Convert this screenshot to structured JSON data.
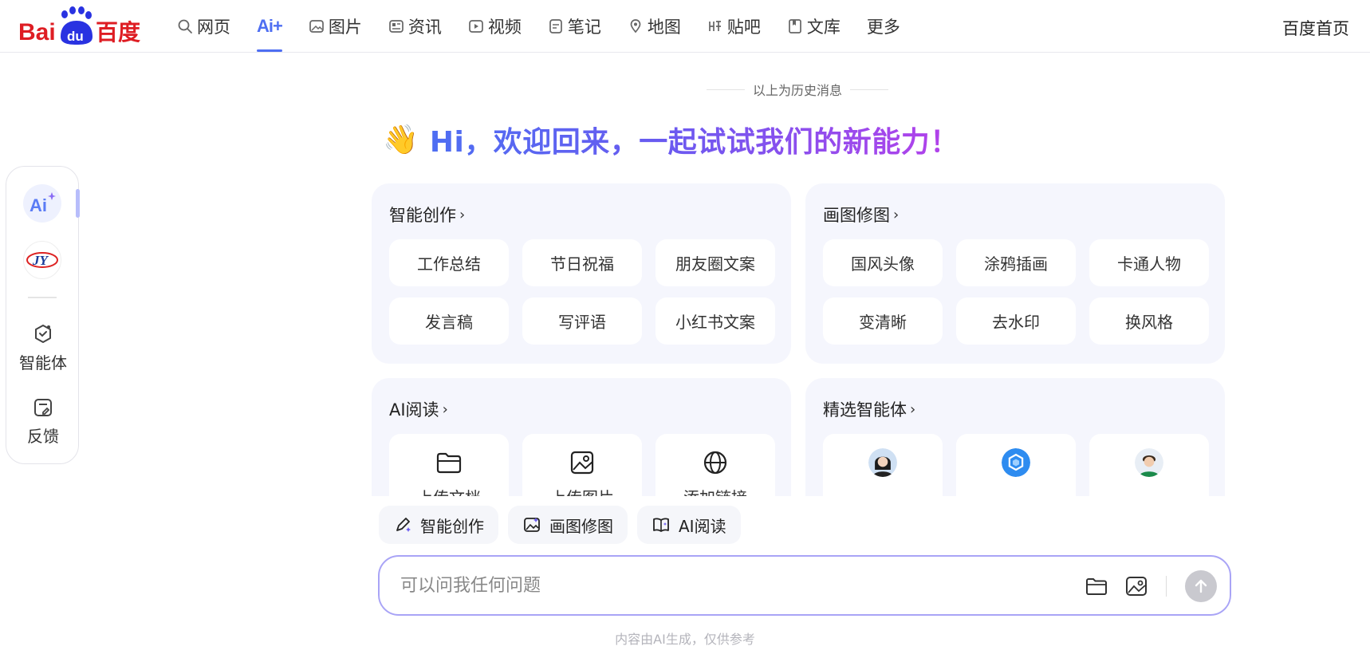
{
  "logo": {
    "text_left": "Bai",
    "text_du": "du",
    "text_right": "百度"
  },
  "nav": {
    "items": [
      {
        "label": "网页",
        "icon": "search-icon"
      },
      {
        "label": "Ai+",
        "icon": "ai-icon",
        "active": true
      },
      {
        "label": "图片",
        "icon": "image-icon"
      },
      {
        "label": "资讯",
        "icon": "news-icon"
      },
      {
        "label": "视频",
        "icon": "video-icon"
      },
      {
        "label": "笔记",
        "icon": "note-icon"
      },
      {
        "label": "地图",
        "icon": "map-icon"
      },
      {
        "label": "贴吧",
        "icon": "tieba-icon"
      },
      {
        "label": "文库",
        "icon": "library-icon"
      },
      {
        "label": "更多"
      }
    ],
    "home_link": "百度首页"
  },
  "rail": {
    "ai_avatar_label": "Ai",
    "jy_avatar_label": "JY",
    "agent_label": "智能体",
    "feedback_label": "反馈"
  },
  "history_label": "以上为历史消息",
  "greeting": {
    "emoji": "👋",
    "text": "Hi，欢迎回来，一起试试我们的新能力！"
  },
  "cards": {
    "creation": {
      "title": "智能创作",
      "chips": [
        "工作总结",
        "节日祝福",
        "朋友圈文案",
        "发言稿",
        "写评语",
        "小红书文案"
      ]
    },
    "image": {
      "title": "画图修图",
      "chips": [
        "国风头像",
        "涂鸦插画",
        "卡通人物",
        "变清晰",
        "去水印",
        "换风格"
      ]
    },
    "reading": {
      "title": "AI阅读",
      "tiles": [
        {
          "label": "上传文档",
          "icon": "folder-icon"
        },
        {
          "label": "上传图片",
          "icon": "image-icon"
        },
        {
          "label": "添加链接",
          "icon": "globe-icon"
        }
      ]
    },
    "agents": {
      "title": "精选智能体",
      "tiles": [
        {
          "label": "",
          "icon": "agent-avatar-woman"
        },
        {
          "label": "",
          "icon": "agent-avatar-cube"
        },
        {
          "label": "",
          "icon": "agent-avatar-man"
        }
      ]
    }
  },
  "pills": [
    {
      "label": "智能创作",
      "icon": "pen-sparkle-icon"
    },
    {
      "label": "画图修图",
      "icon": "image-edit-icon"
    },
    {
      "label": "AI阅读",
      "icon": "book-icon"
    }
  ],
  "input": {
    "placeholder": "可以问我任何问题",
    "value": ""
  },
  "disclaimer": "内容由AI生成，仅供参考",
  "colors": {
    "brand_red": "#de1d23",
    "brand_blue": "#2932e1",
    "accent": "#4e6ef2",
    "gradient_end": "#b640ea"
  }
}
